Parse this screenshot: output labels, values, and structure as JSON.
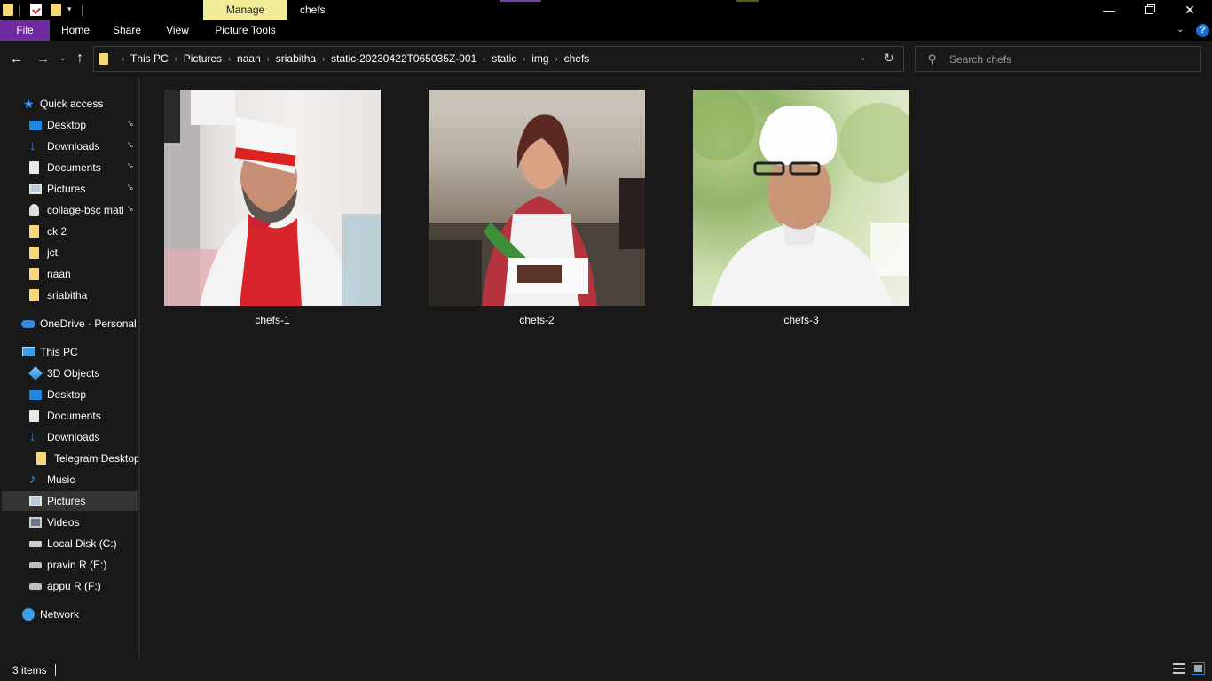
{
  "window": {
    "title": "chefs",
    "context_tab": "Manage",
    "buttons": {
      "minimize": "—",
      "maximize": "",
      "close": "✕"
    }
  },
  "quick_access_toolbar": {
    "dropdown": "▾"
  },
  "ribbon": {
    "tabs": [
      "File",
      "Home",
      "Share",
      "View",
      "Picture Tools"
    ],
    "expand": "⌄",
    "help": "?"
  },
  "navigation": {
    "back": "←",
    "forward": "→",
    "recent": "⌄",
    "up": "↑"
  },
  "address": {
    "breadcrumb": [
      "This PC",
      "Pictures",
      "naan",
      "sriabitha",
      "static-20230422T065035Z-001",
      "static",
      "img",
      "chefs"
    ],
    "separator": "›",
    "dropdown": "⌄",
    "refresh": "↻"
  },
  "search": {
    "placeholder": "Search chefs",
    "value": "",
    "icon_glyph": "⚲"
  },
  "sidebar": {
    "pin_glyph": "📌",
    "quick_access": {
      "label": "Quick access",
      "items": [
        {
          "label": "Desktop",
          "icon": "desktop-icon",
          "pinned": true
        },
        {
          "label": "Downloads",
          "icon": "downloads-icon",
          "pinned": true
        },
        {
          "label": "Documents",
          "icon": "documents-icon",
          "pinned": true
        },
        {
          "label": "Pictures",
          "icon": "pictures-icon",
          "pinned": true
        },
        {
          "label": "collage-bsc matl",
          "icon": "user-folder-icon",
          "pinned": true
        },
        {
          "label": "ck 2",
          "icon": "folder-icon",
          "pinned": false
        },
        {
          "label": "jct",
          "icon": "folder-icon",
          "pinned": false
        },
        {
          "label": "naan",
          "icon": "folder-icon",
          "pinned": false
        },
        {
          "label": "sriabitha",
          "icon": "folder-icon",
          "pinned": false
        }
      ]
    },
    "onedrive": {
      "label": "OneDrive - Personal"
    },
    "this_pc": {
      "label": "This PC",
      "items": [
        {
          "label": "3D Objects",
          "icon": "3d-objects-icon"
        },
        {
          "label": "Desktop",
          "icon": "desktop-icon"
        },
        {
          "label": "Documents",
          "icon": "documents-icon"
        },
        {
          "label": "Downloads",
          "icon": "downloads-icon"
        },
        {
          "label": "Telegram Desktop",
          "icon": "folder-icon"
        },
        {
          "label": "Music",
          "icon": "music-icon"
        },
        {
          "label": "Pictures",
          "icon": "pictures-icon",
          "selected": true
        },
        {
          "label": "Videos",
          "icon": "videos-icon"
        },
        {
          "label": "Local Disk (C:)",
          "icon": "local-disk-icon"
        },
        {
          "label": "pravin R  (E:)",
          "icon": "drive-icon"
        },
        {
          "label": "appu R  (F:)",
          "icon": "drive-icon"
        }
      ]
    },
    "network": {
      "label": "Network"
    }
  },
  "files": [
    {
      "name": "chefs-1"
    },
    {
      "name": "chefs-2"
    },
    {
      "name": "chefs-3"
    }
  ],
  "status": {
    "item_count": "3 items"
  },
  "colors": {
    "file_tab": "#6e2aa0",
    "manage_tab": "#f1ec97",
    "background": "#191919",
    "accent_blue": "#2f88e6"
  }
}
